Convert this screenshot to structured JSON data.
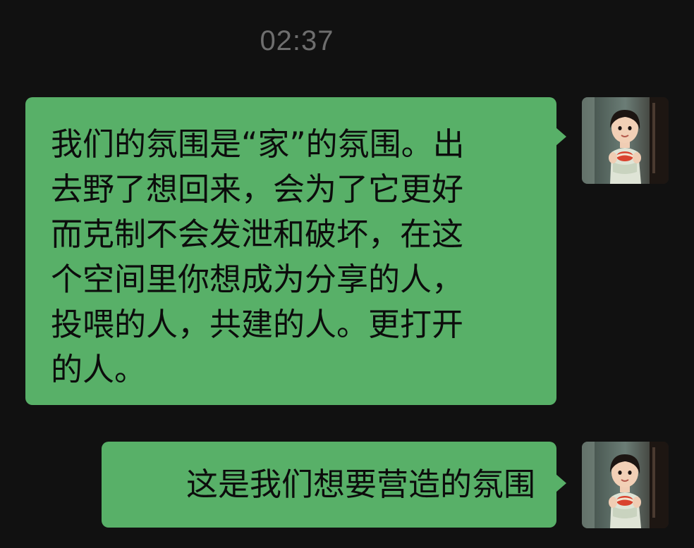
{
  "chat": {
    "timestamp": "02:37",
    "messages": [
      {
        "side": "right",
        "lines": [
          "我们的氛围是“家”的氛围。出",
          "去野了想回来，会为了它更好",
          "而克制不会发泄和破坏，在这",
          "个空间里你想成为分享的人，",
          "投喂的人，共建的人。更打开",
          "的人。"
        ]
      },
      {
        "side": "right",
        "text": "这是我们想要营造的氛围"
      }
    ]
  },
  "theme": {
    "background": "#111111",
    "bubble_color": "#58b068",
    "timestamp_color": "#6e6e6e",
    "text_color": "#0c0c0c"
  },
  "icons": {
    "avatar": "user-avatar-photo"
  }
}
